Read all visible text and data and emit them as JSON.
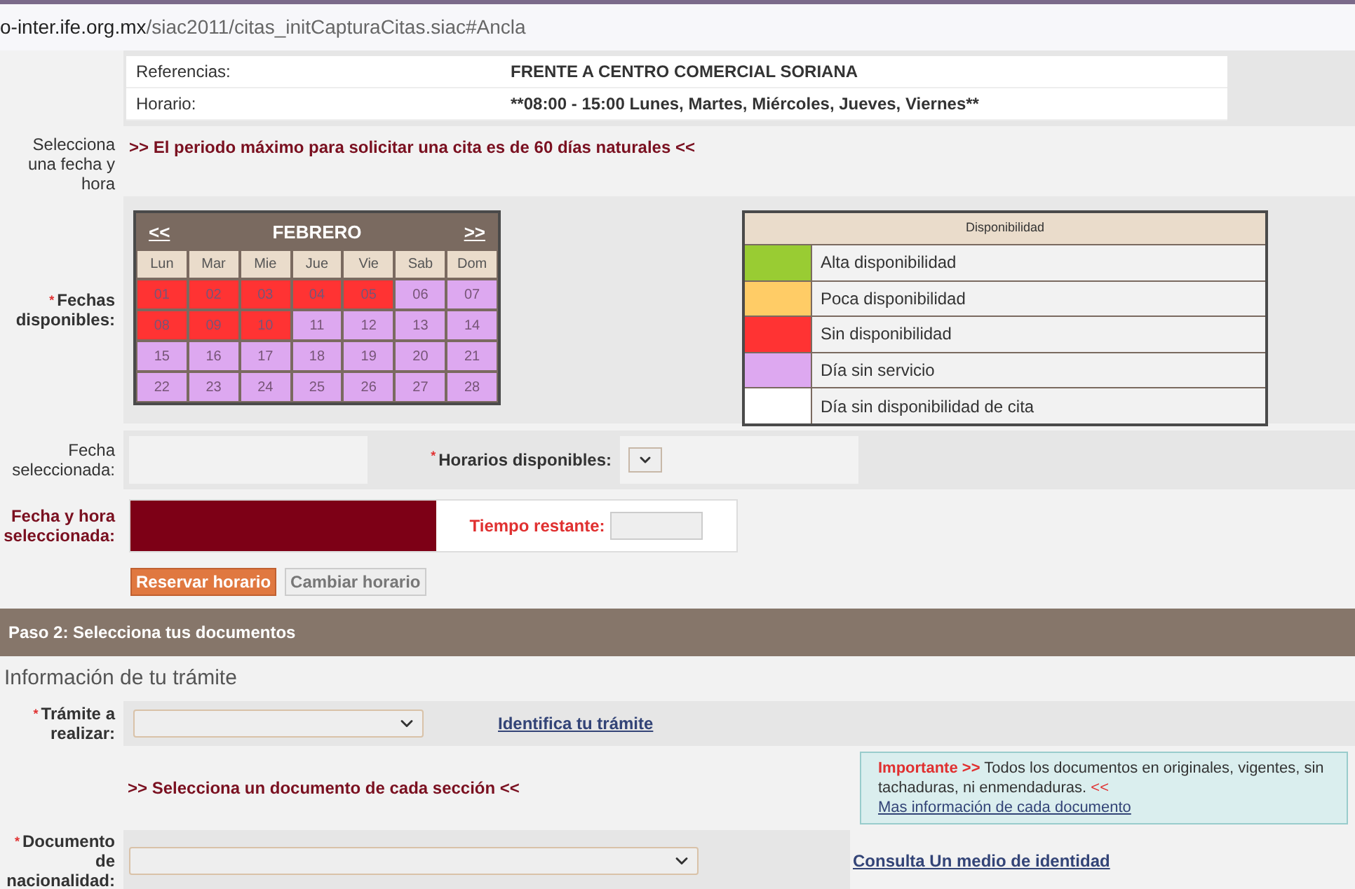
{
  "address_bar": {
    "host": "o-inter.ife.org.mx",
    "path": "/siac2011/citas_initCapturaCitas.siac#Ancla"
  },
  "office_info": [
    {
      "label": "Referencias:",
      "value": "FRENTE A CENTRO COMERCIAL SORIANA"
    },
    {
      "label": "Horario:",
      "value": "**08:00 - 15:00 Lunes, Martes, Miércoles, Jueves, Viernes**"
    }
  ],
  "select_date": {
    "label": "Selecciona una fecha y hora",
    "notice": ">> El periodo máximo para solicitar una cita es de 60 días naturales <<"
  },
  "calendar": {
    "required_mark": "*",
    "label": "Fechas disponibles:",
    "prev": "<<",
    "month": "FEBRERO",
    "next": ">>",
    "weekdays": [
      "Lun",
      "Mar",
      "Mie",
      "Jue",
      "Vie",
      "Sab",
      "Dom"
    ],
    "days": [
      {
        "day": "01",
        "color": "#ff3333"
      },
      {
        "day": "02",
        "color": "#ff3333"
      },
      {
        "day": "03",
        "color": "#ff3333"
      },
      {
        "day": "04",
        "color": "#ff3333"
      },
      {
        "day": "05",
        "color": "#ff3333"
      },
      {
        "day": "06",
        "color": "#dda8f0"
      },
      {
        "day": "07",
        "color": "#dda8f0"
      },
      {
        "day": "08",
        "color": "#ff3333"
      },
      {
        "day": "09",
        "color": "#ff3333"
      },
      {
        "day": "10",
        "color": "#ff3333"
      },
      {
        "day": "11",
        "color": "#dda8f0"
      },
      {
        "day": "12",
        "color": "#dda8f0"
      },
      {
        "day": "13",
        "color": "#dda8f0"
      },
      {
        "day": "14",
        "color": "#dda8f0"
      },
      {
        "day": "15",
        "color": "#dda8f0"
      },
      {
        "day": "16",
        "color": "#dda8f0"
      },
      {
        "day": "17",
        "color": "#dda8f0"
      },
      {
        "day": "18",
        "color": "#dda8f0"
      },
      {
        "day": "19",
        "color": "#dda8f0"
      },
      {
        "day": "20",
        "color": "#dda8f0"
      },
      {
        "day": "21",
        "color": "#dda8f0"
      },
      {
        "day": "22",
        "color": "#dda8f0"
      },
      {
        "day": "23",
        "color": "#dda8f0"
      },
      {
        "day": "24",
        "color": "#dda8f0"
      },
      {
        "day": "25",
        "color": "#dda8f0"
      },
      {
        "day": "26",
        "color": "#dda8f0"
      },
      {
        "day": "27",
        "color": "#dda8f0"
      },
      {
        "day": "28",
        "color": "#dda8f0"
      }
    ]
  },
  "legend": {
    "title": "Disponibilidad",
    "items": [
      {
        "label": "Alta disponibilidad",
        "color": "#99cc33"
      },
      {
        "label": "Poca disponibilidad",
        "color": "#ffcc66"
      },
      {
        "label": "Sin disponibilidad",
        "color": "#ff3333"
      },
      {
        "label": "Día sin servicio",
        "color": "#dda8f0"
      },
      {
        "label": "Día sin disponibilidad de cita",
        "color": "#ffffff"
      }
    ]
  },
  "selected_date": {
    "label": "Fecha seleccionada:"
  },
  "schedules": {
    "required_mark": "*",
    "label": "Horarios disponibles:"
  },
  "selected_datetime": {
    "label": "Fecha y hora seleccionada:",
    "remaining_label": "Tiempo restante:"
  },
  "buttons": [
    {
      "label": "Reservar horario",
      "kind": "primary"
    },
    {
      "label": "Cambiar horario",
      "kind": "secondary"
    }
  ],
  "step2": {
    "title": "Paso 2: Selecciona tus documentos"
  },
  "section_title": "Información de tu trámite",
  "tramite": {
    "required_mark": "*",
    "label": "Trámite a realizar:",
    "link": "Identifica tu trámite"
  },
  "documents_notice": ">> Selecciona un documento de cada sección <<",
  "important": {
    "label": "Importante",
    "open_mark": ">>",
    "text": "Todos los documentos en originales, vigentes, sin tachaduras, ni enmendaduras.",
    "close_mark": "<<",
    "link": "Mas información de cada documento"
  },
  "nationality": {
    "required_mark": "*",
    "label": "Documento de nacionalidad:",
    "link": "Consulta Un medio de identidad"
  }
}
